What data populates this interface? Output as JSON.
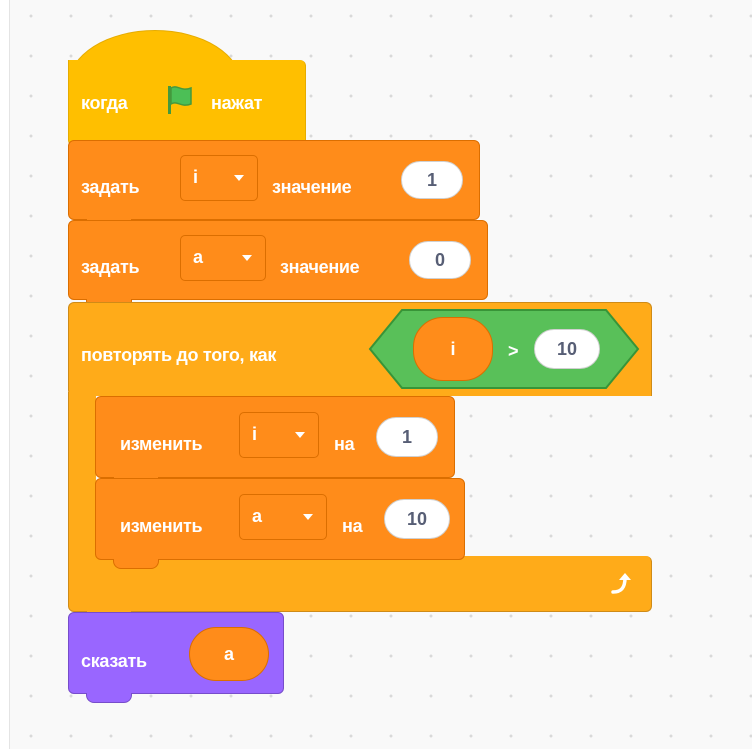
{
  "script": {
    "when_flag": {
      "label_before": "когда",
      "label_after": "нажат",
      "icon": "green-flag-icon"
    },
    "set_i": {
      "label": "задать",
      "variable": "i",
      "value_label": "значение",
      "value": "1"
    },
    "set_a": {
      "label": "задать",
      "variable": "a",
      "value_label": "значение",
      "value": "0"
    },
    "repeat_until": {
      "label": "повторять до того, как",
      "condition": {
        "left_variable": "i",
        "operator": ">",
        "right_value": "10"
      },
      "loop_icon": "loop-arrow-icon"
    },
    "change_i": {
      "label": "изменить",
      "variable": "i",
      "by_label": "на",
      "value": "1"
    },
    "change_a": {
      "label": "изменить",
      "variable": "a",
      "by_label": "на",
      "value": "10"
    },
    "say": {
      "label": "сказать",
      "variable": "a"
    }
  },
  "colors": {
    "events": "#ffbf00",
    "variables": "#ff8c1a",
    "control": "#ffab19",
    "operators": "#59c059",
    "looks": "#9966ff",
    "workspace": "#f9f9f9"
  }
}
